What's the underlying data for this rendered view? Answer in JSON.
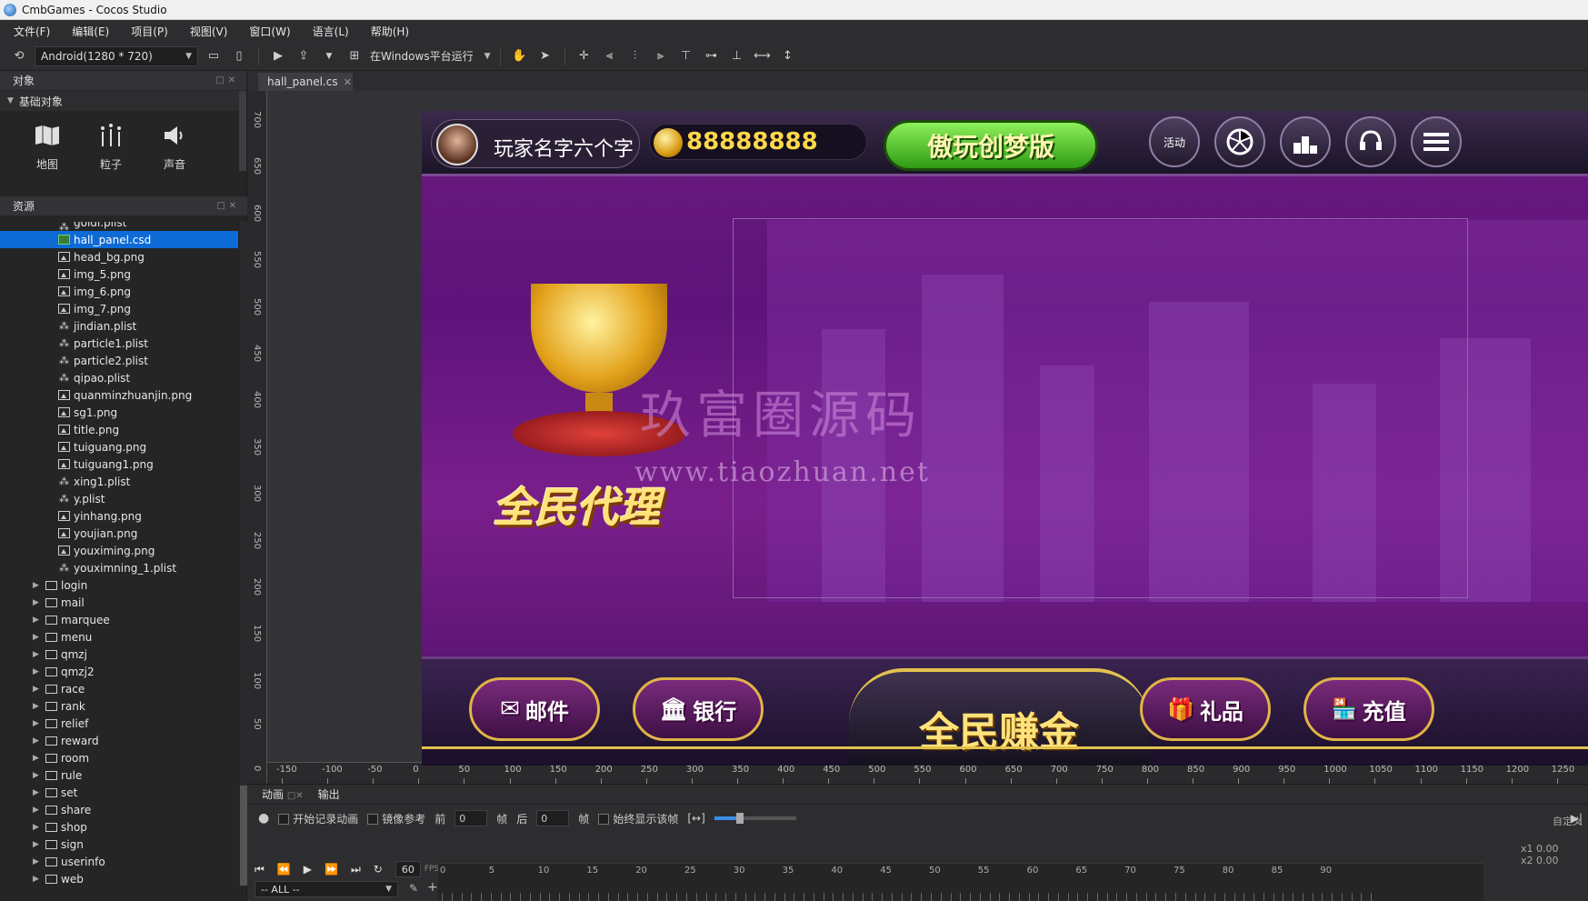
{
  "window": {
    "title": "CmbGames - Cocos Studio"
  },
  "menu": [
    "文件(F)",
    "编辑(E)",
    "项目(P)",
    "视图(V)",
    "窗口(W)",
    "语言(L)",
    "帮助(H)"
  ],
  "toolbar": {
    "resolution": "Android(1280 * 720)",
    "run_label": "在Windows平台运行"
  },
  "objects_panel": {
    "title": "对象",
    "section": "基础对象",
    "items": [
      {
        "label": "地图",
        "icon": "map-icon"
      },
      {
        "label": "粒子",
        "icon": "particle-icon"
      },
      {
        "label": "声音",
        "icon": "sound-icon"
      }
    ]
  },
  "resources_panel": {
    "title": "资源",
    "files": [
      {
        "name": "goldi.plist",
        "type": "plist",
        "partial": true
      },
      {
        "name": "hall_panel.csd",
        "type": "csd",
        "selected": true
      },
      {
        "name": "head_bg.png",
        "type": "img"
      },
      {
        "name": "img_5.png",
        "type": "img"
      },
      {
        "name": "img_6.png",
        "type": "img"
      },
      {
        "name": "img_7.png",
        "type": "img"
      },
      {
        "name": "jindian.plist",
        "type": "plist"
      },
      {
        "name": "particle1.plist",
        "type": "plist"
      },
      {
        "name": "particle2.plist",
        "type": "plist"
      },
      {
        "name": "qipao.plist",
        "type": "plist"
      },
      {
        "name": "quanminzhuanjin.png",
        "type": "img"
      },
      {
        "name": "sg1.png",
        "type": "img"
      },
      {
        "name": "title.png",
        "type": "img"
      },
      {
        "name": "tuiguang.png",
        "type": "img"
      },
      {
        "name": "tuiguang1.png",
        "type": "img"
      },
      {
        "name": "xing1.plist",
        "type": "plist"
      },
      {
        "name": "y.plist",
        "type": "plist"
      },
      {
        "name": "yinhang.png",
        "type": "img"
      },
      {
        "name": "youjian.png",
        "type": "img"
      },
      {
        "name": "youximing.png",
        "type": "img"
      },
      {
        "name": "youximning_1.plist",
        "type": "plist"
      }
    ],
    "folders": [
      "login",
      "mail",
      "marquee",
      "menu",
      "qmzj",
      "qmzj2",
      "race",
      "rank",
      "relief",
      "reward",
      "room",
      "rule",
      "set",
      "share",
      "shop",
      "sign",
      "userinfo",
      "web"
    ]
  },
  "editor": {
    "tab": "hall_panel.cs",
    "ruler_v": [
      "700",
      "650",
      "600",
      "550",
      "500",
      "450",
      "400",
      "350",
      "300",
      "250",
      "200",
      "150",
      "100",
      "50",
      "0"
    ],
    "ruler_h": [
      "-150",
      "-100",
      "-50",
      "0",
      "50",
      "100",
      "150",
      "200",
      "250",
      "300",
      "350",
      "400",
      "450",
      "500",
      "550",
      "600",
      "650",
      "700",
      "750",
      "800",
      "850",
      "900",
      "950",
      "1000",
      "1050",
      "1100",
      "1150",
      "1200",
      "1250"
    ]
  },
  "game": {
    "player_name": "玩家名字六个字",
    "coins": "88888888",
    "version_label": "傲玩创梦版",
    "top_buttons": [
      "活动",
      "",
      "",
      "",
      ""
    ],
    "agent_title": "全民代理",
    "watermark": "玖富圈源码",
    "watermark_url": "www.tiaozhuan.net",
    "bottom_buttons": {
      "mail": "邮件",
      "bank": "银行",
      "center": "全民赚金",
      "gift": "礼品",
      "recharge": "充值"
    }
  },
  "animation_panel": {
    "tabs": [
      "动画",
      "输出"
    ],
    "record_label": "开始记录动画",
    "mirror_label": "镜像参考",
    "before_label": "前",
    "before_value": "0",
    "frame_label": "帧",
    "after_label": "后",
    "after_value": "0",
    "always_show_label": "始终显示该帧",
    "fps": "60",
    "fps_unit": "FPS",
    "all_label": "-- ALL --",
    "custom_label": "自定义",
    "timeline_marks": [
      "0",
      "5",
      "10",
      "15",
      "20",
      "25",
      "30",
      "35",
      "40",
      "45",
      "50",
      "55",
      "60",
      "65",
      "70",
      "75",
      "80",
      "85",
      "90"
    ],
    "x1_label": "x1",
    "x1_value": "0.00",
    "x2_label": "x2",
    "x2_value": "0.00"
  }
}
